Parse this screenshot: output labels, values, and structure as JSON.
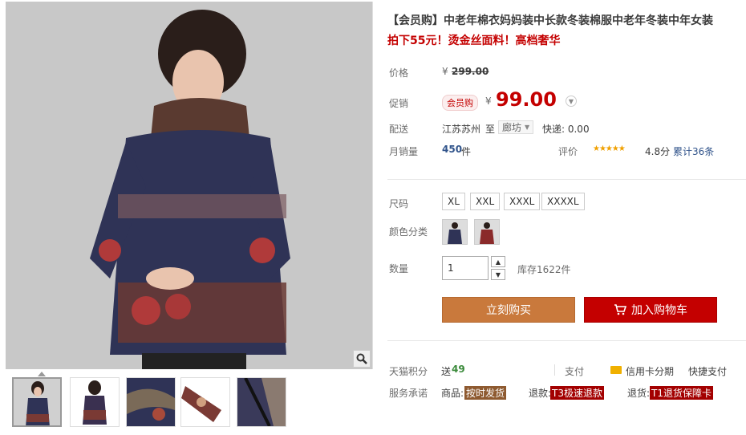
{
  "product": {
    "title": "【会员购】中老年棉衣妈妈装中长款冬装棉服中老年冬装中年女装",
    "subtitle": "拍下55元！烫金丝面料！高档奢华"
  },
  "price": {
    "label": "价格",
    "currency": "¥",
    "original": "299.00"
  },
  "promo": {
    "label": "促销",
    "badge": "会员购",
    "currency": "¥",
    "price": "99.00"
  },
  "shipping": {
    "label": "配送",
    "from": "江苏苏州",
    "to_word": "至",
    "destination": "廊坊",
    "express": "快递: 0.00"
  },
  "sales": {
    "label": "月销量",
    "count": "450",
    "unit": "件",
    "rating_label": "评价",
    "stars": "★★★★★",
    "score": "4.8分",
    "reviews": "累计36条"
  },
  "size": {
    "label": "尺码",
    "options": [
      "XL",
      "XXL",
      "XXXL",
      "XXXXL"
    ]
  },
  "color": {
    "label": "颜色分类"
  },
  "quantity": {
    "label": "数量",
    "value": "1",
    "stock": "库存1622件"
  },
  "actions": {
    "buy": "立刻购买",
    "cart": "加入购物车"
  },
  "footer": {
    "points_label": "天猫积分",
    "points_text": "送",
    "points_value": "49",
    "pay_label": "支付",
    "credit": "信用卡分期",
    "quick_pay": "快捷支付",
    "service_label": "服务承诺",
    "goods": "商品:",
    "goods_tag": "按时发货",
    "refund": "退款:",
    "refund_tag": "T3极速退款",
    "return": "退货:",
    "return_tag": "T1退货保障卡"
  },
  "colors": {
    "accent_red": "#c40000",
    "buy_orange": "#c9793c",
    "star": "#f0a000"
  }
}
